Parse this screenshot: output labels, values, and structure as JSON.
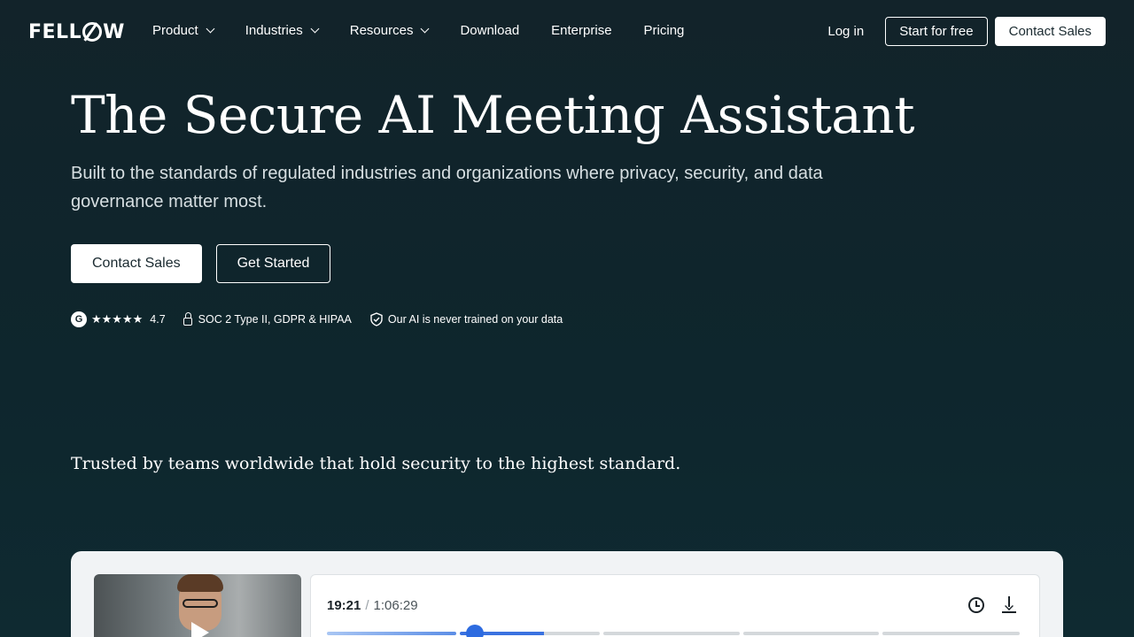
{
  "nav": {
    "logo": "FELLOW",
    "items": [
      {
        "label": "Product",
        "dropdown": true
      },
      {
        "label": "Industries",
        "dropdown": true
      },
      {
        "label": "Resources",
        "dropdown": true
      },
      {
        "label": "Download",
        "dropdown": false
      },
      {
        "label": "Enterprise",
        "dropdown": false
      },
      {
        "label": "Pricing",
        "dropdown": false
      }
    ],
    "login": "Log in",
    "start_free": "Start for free",
    "contact_sales": "Contact Sales"
  },
  "hero": {
    "title": "The Secure AI Meeting Assistant",
    "subtitle": "Built to the standards of regulated industries and organizations where privacy, security, and data governance matter most.",
    "primary_cta": "Contact Sales",
    "secondary_cta": "Get Started",
    "rating_badge": "G",
    "stars": "★★★★★",
    "rating": "4.7",
    "compliance": "SOC 2 Type II, GDPR & HIPAA",
    "ai_privacy": "Our AI is never trained on your data"
  },
  "trusted": {
    "text": "Trusted by teams worldwide that hold security to the highest standard."
  },
  "player": {
    "current_time": "19:21",
    "separator": "/",
    "total_time": "1:06:29",
    "progress": 0.24
  },
  "colors": {
    "background": "#12232a",
    "accent": "#2d6be0"
  }
}
